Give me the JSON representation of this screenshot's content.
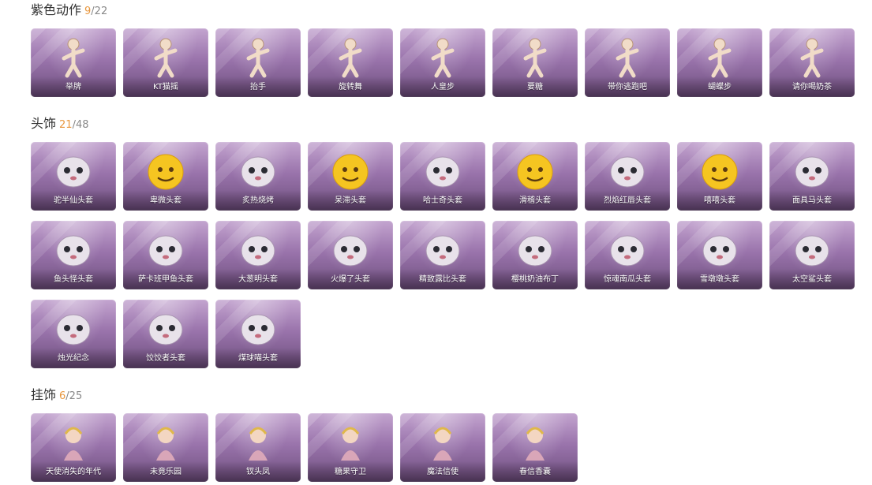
{
  "sections": [
    {
      "title": "紫色动作",
      "owned": "9",
      "total": "/22",
      "items": [
        {
          "label": "举牌",
          "icon": "sign-holding-figure-icon"
        },
        {
          "label": "KT猫摇",
          "icon": "dancing-figure-icon"
        },
        {
          "label": "抬手",
          "icon": "raise-hand-figure-icon"
        },
        {
          "label": "旋转舞",
          "icon": "spin-dance-figure-icon"
        },
        {
          "label": "人皇步",
          "icon": "sparkle-figure-icon"
        },
        {
          "label": "要糖",
          "icon": "candy-figure-icon"
        },
        {
          "label": "带你逃跑吧",
          "icon": "running-figure-icon"
        },
        {
          "label": "蝴蝶步",
          "icon": "butterfly-step-figure-icon"
        },
        {
          "label": "请你喝奶茶",
          "icon": "milk-tea-figure-icon"
        }
      ]
    },
    {
      "title": "头饰",
      "owned": "21",
      "total": "/48",
      "items": [
        {
          "label": "驼半仙头套",
          "icon": "raccoon-sunglasses-icon"
        },
        {
          "label": "卑微头套",
          "icon": "sad-emoji-icon"
        },
        {
          "label": "炙热烧烤",
          "icon": "bbq-head-icon"
        },
        {
          "label": "呆滞头套",
          "icon": "dazed-emoji-icon"
        },
        {
          "label": "哈士奇头套",
          "icon": "husky-sunglasses-icon"
        },
        {
          "label": "滑稽头套",
          "icon": "funny-emoji-icon"
        },
        {
          "label": "烈焰红唇头套",
          "icon": "pikachu-sunglasses-icon"
        },
        {
          "label": "嘻嘻头套",
          "icon": "grin-emoji-icon"
        },
        {
          "label": "面具马头套",
          "icon": "horse-mask-icon"
        },
        {
          "label": "鱼头怪头套",
          "icon": "fish-head-icon"
        },
        {
          "label": "萨卡班甲鱼头套",
          "icon": "sacabambaspis-icon"
        },
        {
          "label": "大葱明头套",
          "icon": "green-onion-icon"
        },
        {
          "label": "火爆了头套",
          "icon": "fire-spirit-icon"
        },
        {
          "label": "精致露比头套",
          "icon": "pink-pig-icon"
        },
        {
          "label": "樱桃奶油布丁",
          "icon": "pudding-icon"
        },
        {
          "label": "惊魂南瓜头套",
          "icon": "pumpkin-icon"
        },
        {
          "label": "雪墩墩头套",
          "icon": "snowman-icon"
        },
        {
          "label": "太空鲨头套",
          "icon": "space-shark-icon"
        },
        {
          "label": "烛光纪念",
          "icon": "candle-icon"
        },
        {
          "label": "饺饺者头套",
          "icon": "dumpling-icon"
        },
        {
          "label": "煤球喵头套",
          "icon": "black-cat-icon"
        }
      ]
    },
    {
      "title": "挂饰",
      "owned": "6",
      "total": "/25",
      "items": [
        {
          "label": "天使消失的年代",
          "icon": "angel-girl-icon"
        },
        {
          "label": "未竟乐园",
          "icon": "pink-hair-girl-icon"
        },
        {
          "label": "钗头凤",
          "icon": "headdress-girl-icon"
        },
        {
          "label": "糖果守卫",
          "icon": "candy-lantern-icon"
        },
        {
          "label": "魔法信使",
          "icon": "elephant-messenger-icon"
        },
        {
          "label": "春信香囊",
          "icon": "sachet-icon"
        }
      ]
    }
  ]
}
